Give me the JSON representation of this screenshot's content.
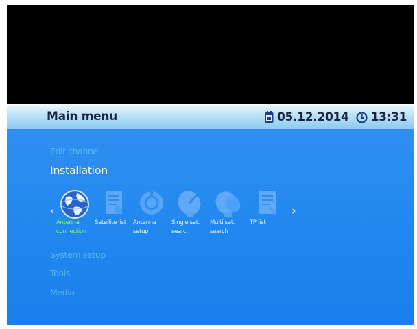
{
  "header": {
    "title": "Main menu",
    "date": "05.12.2014",
    "time": "13:31",
    "date_icon": "calendar-icon",
    "time_icon": "clock-icon"
  },
  "menu": {
    "edit_channel": "Edit channel",
    "installation": "Installation",
    "system_setup": "System setup",
    "tools": "Tools",
    "media": "Media"
  },
  "installation_items": [
    {
      "label": "Antenna\nconnection",
      "icon": "globe-icon",
      "selected": true
    },
    {
      "label": "Satellite list",
      "icon": "satellite-list-icon",
      "selected": false
    },
    {
      "label": "Antenna\nsetup",
      "icon": "antenna-setup-icon",
      "selected": false
    },
    {
      "label": "Single sat.\nsearch",
      "icon": "single-sat-search-icon",
      "selected": false
    },
    {
      "label": "Multi sat.\nsearch",
      "icon": "multi-sat-search-icon",
      "selected": false
    },
    {
      "label": "TP list",
      "icon": "tp-list-icon",
      "selected": false
    }
  ],
  "colors": {
    "header_text": "#172544",
    "background_blue": "#1f86f0",
    "dim_item": "#59b6f4",
    "selected_label": "#8cff3c"
  }
}
